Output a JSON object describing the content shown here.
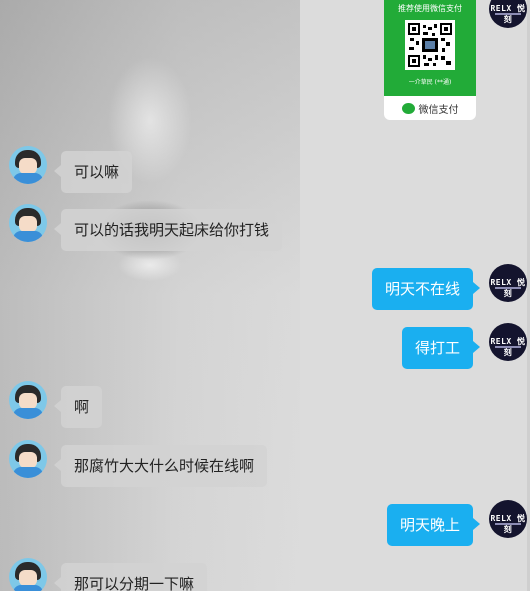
{
  "qr_card": {
    "title": "推荐使用微信支付",
    "caption": "一介草民 (**通)",
    "footer_label": "微信支付",
    "accent": "#22ab38"
  },
  "self_avatar": {
    "brand_text": "RELX 悦刻"
  },
  "messages": [
    {
      "side": "left",
      "text": "可以嘛"
    },
    {
      "side": "left",
      "text": "可以的话我明天起床给你打钱"
    },
    {
      "side": "right",
      "text": "明天不在线"
    },
    {
      "side": "right",
      "text": "得打工"
    },
    {
      "side": "left",
      "text": "啊"
    },
    {
      "side": "left",
      "text": "那腐竹大大什么时候在线啊"
    },
    {
      "side": "right",
      "text": "明天晚上"
    },
    {
      "side": "left",
      "text": "那可以分期一下嘛"
    }
  ],
  "colors": {
    "self_bubble": "#1aaff0",
    "other_bubble": "#d2d2d2",
    "background": "#dcdcdc"
  }
}
